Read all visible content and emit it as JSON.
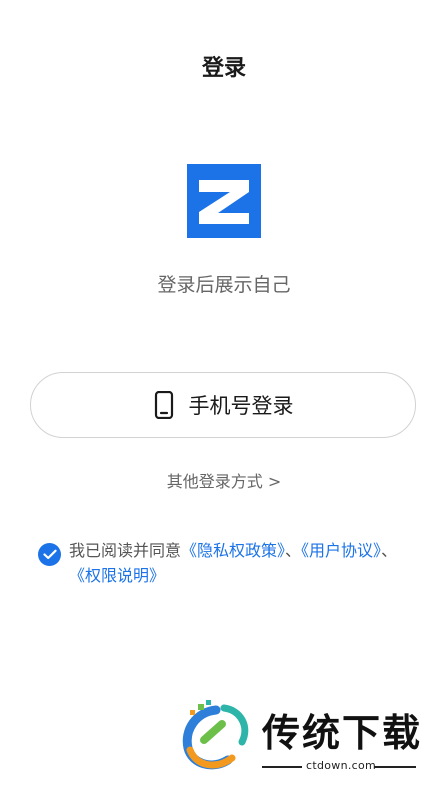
{
  "header": {
    "title": "登录"
  },
  "logo": {
    "icon": "z-logo-icon",
    "color": "#1c73e8"
  },
  "tagline": "登录后展示自己",
  "phone_login": {
    "label": "手机号登录",
    "icon": "phone-icon"
  },
  "other_login": {
    "label": "其他登录方式 >"
  },
  "agreement": {
    "checked": true,
    "prefix": "我已阅读并同意",
    "privacy_link": "《隐私权政策》",
    "sep1": "、",
    "user_link": "《用户协议》",
    "sep2": "、",
    "permission_link": "《权限说明》"
  },
  "watermark": {
    "text": "传统下载",
    "url": "ctdown.com"
  },
  "colors": {
    "accent": "#1c73e8",
    "text_secondary": "#666666"
  }
}
